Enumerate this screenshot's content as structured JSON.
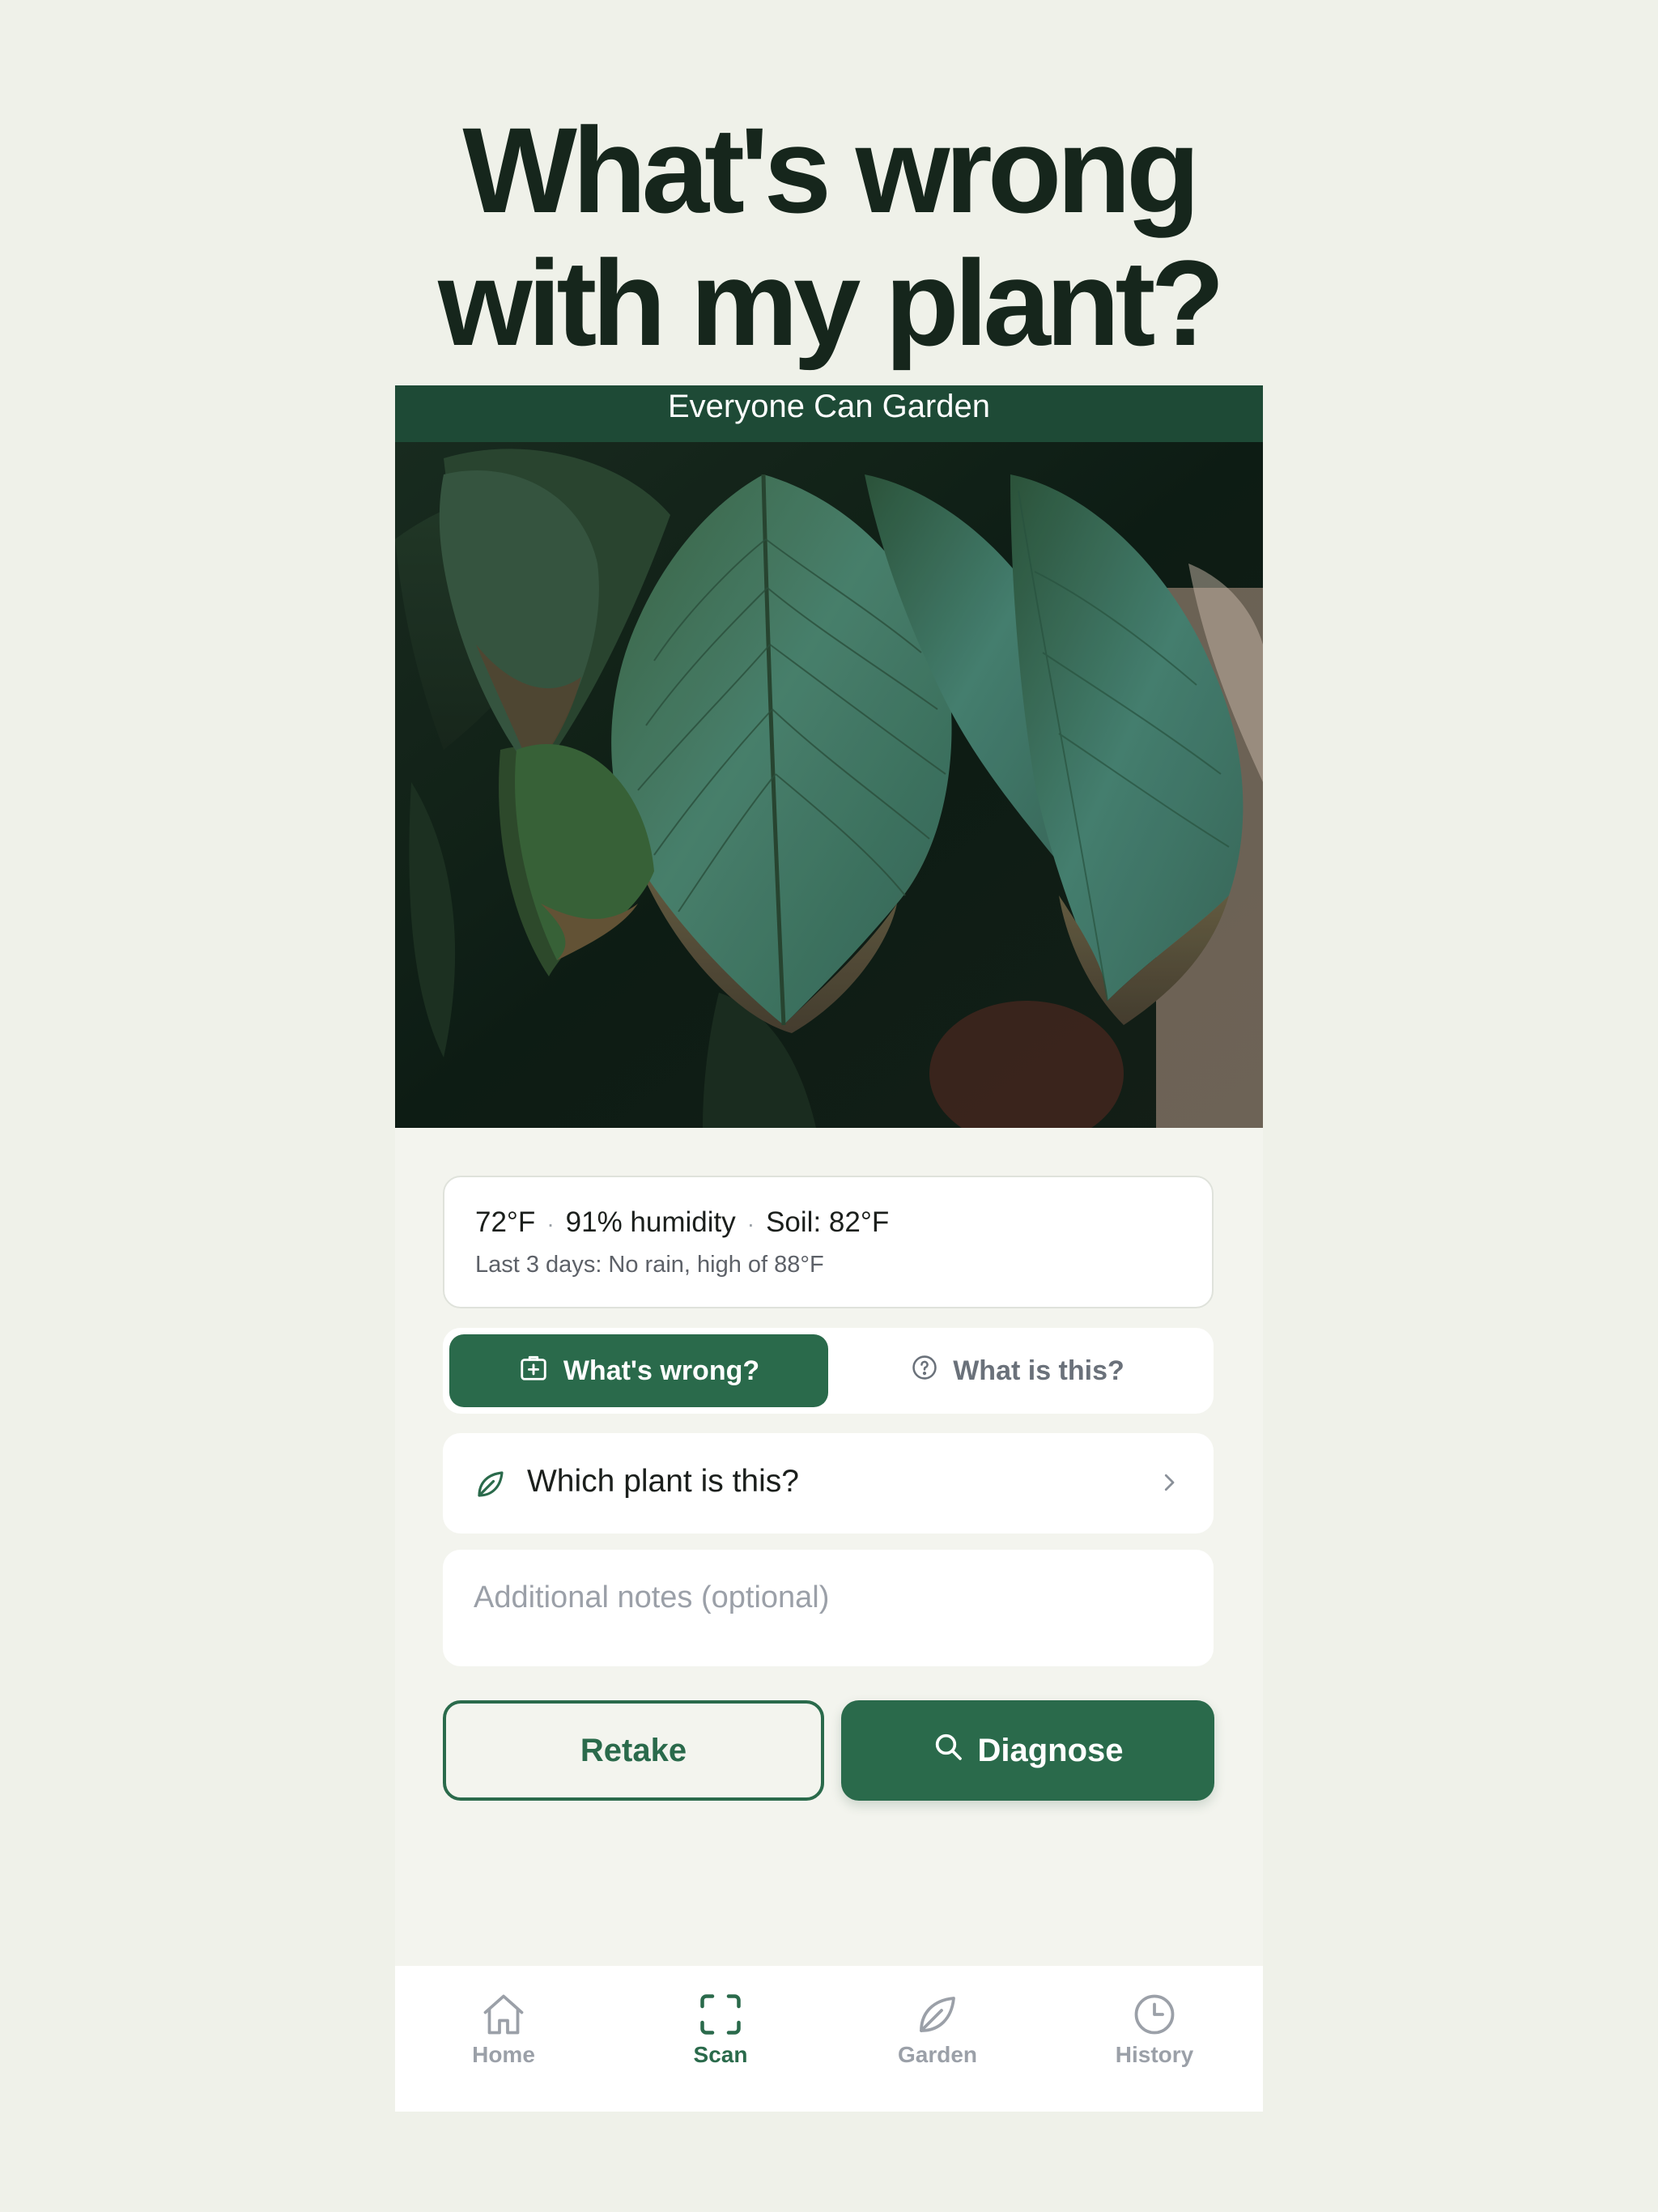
{
  "headline": {
    "line1": "What's wrong",
    "line2": "with my plant?"
  },
  "app": {
    "status_title": "Everyone Can Garden"
  },
  "weather": {
    "temp": "72°F",
    "separator": "·",
    "humidity": "91% humidity",
    "soil": "Soil: 82°F",
    "summary": "Last 3 days: No rain, high of 88°F"
  },
  "mode_toggle": {
    "active_label": "What's wrong?",
    "inactive_label": "What is this?",
    "active_icon": "medical-kit-icon",
    "inactive_icon": "question-circle-icon"
  },
  "plant_picker": {
    "label": "Which plant is this?",
    "icon": "leaf-icon"
  },
  "notes": {
    "placeholder": "Additional notes (optional)",
    "value": ""
  },
  "actions": {
    "retake_label": "Retake",
    "diagnose_label": "Diagnose"
  },
  "tabbar": {
    "items": [
      {
        "label": "Home",
        "icon": "home-icon",
        "active": false
      },
      {
        "label": "Scan",
        "icon": "scan-icon",
        "active": true
      },
      {
        "label": "Garden",
        "icon": "leaf-icon",
        "active": false
      },
      {
        "label": "History",
        "icon": "clock-icon",
        "active": false
      }
    ]
  },
  "colors": {
    "brand": "#2a6a4b",
    "status_bar": "#1e4a36",
    "page_bg": "#eff1e9",
    "headline": "#16261c"
  }
}
